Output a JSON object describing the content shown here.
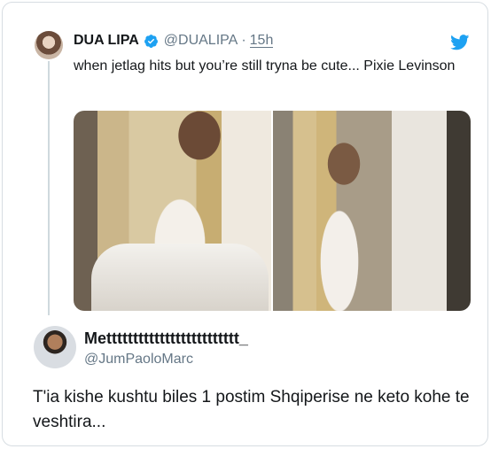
{
  "quoted_tweet": {
    "author_name": "DUA LIPA",
    "handle": "@DUALIPA",
    "separator": "·",
    "time": "15h",
    "text": "when jetlag hits but you’re still tryna be cute... Pixie Levinson",
    "verified": true,
    "icons": [
      "verified-badge-icon",
      "twitter-bird-icon"
    ],
    "brand_color": "#1da1f2"
  },
  "reply": {
    "author_name": "Mettttttttttttttttttttttttt_",
    "handle": "@JumPaoloMarc",
    "text": "T'ia kishe kushtu biles 1 postim Shqiperise ne keto kohe te veshtira..."
  },
  "colors": {
    "text_primary": "#14171a",
    "text_secondary": "#657786",
    "border": "#d7dde2"
  }
}
